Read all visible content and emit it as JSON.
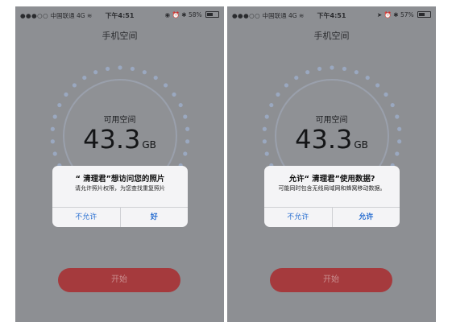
{
  "phones": [
    {
      "status": {
        "carrier": "中国联通",
        "network": "4G",
        "time": "下午4:51",
        "battery": "58%",
        "battery_level": 0.58
      },
      "title": "手机空间",
      "available_label": "可用空间",
      "storage_value": "43.3",
      "storage_unit": "GB",
      "dialog": {
        "title": "“ 清理君”想访问您的照片",
        "message": "请允许照片权限，为您查找重复照片",
        "cancel_label": "不允许",
        "confirm_label": "好"
      },
      "start_label": "开始"
    },
    {
      "status": {
        "carrier": "中国联通",
        "network": "4G",
        "time": "下午4:51",
        "battery": "57%",
        "battery_level": 0.57
      },
      "title": "手机空间",
      "available_label": "可用空间",
      "storage_value": "43.3",
      "storage_unit": "GB",
      "dialog": {
        "title": "允许“ 清理君”使用数据?",
        "message": "可能同时包含无线局域网和蜂窝移动数据。",
        "cancel_label": "不允许",
        "confirm_label": "允许"
      },
      "start_label": "开始"
    }
  ],
  "colors": {
    "background": "#8d8f93",
    "dots": "#9aa8c0",
    "start_button": "#a53a3d",
    "dialog_button": "#2a6fd1"
  }
}
